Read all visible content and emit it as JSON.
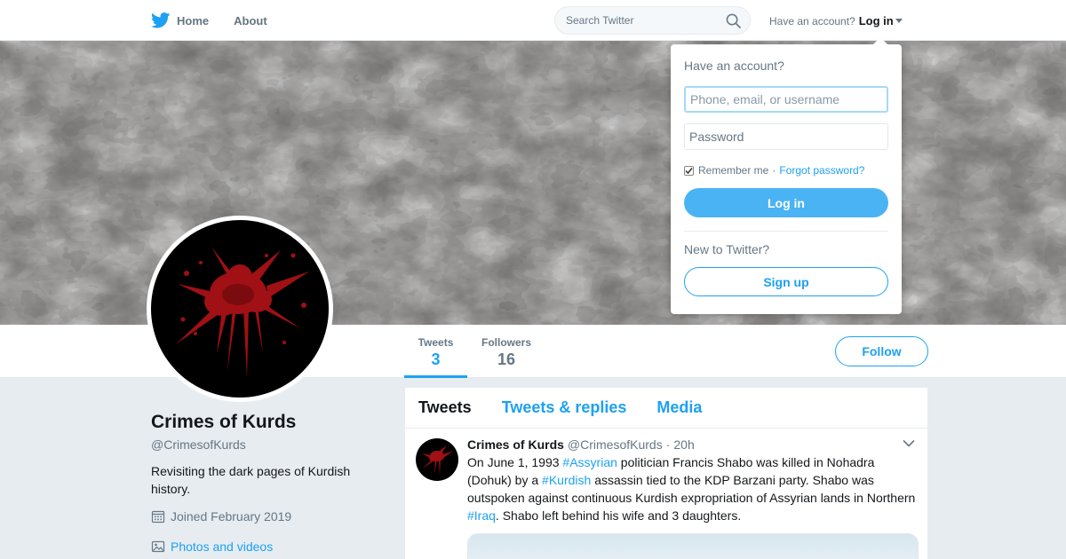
{
  "nav": {
    "home_label": "Home",
    "about_label": "About",
    "search_placeholder": "Search Twitter",
    "account_prompt": "Have an account?",
    "login_label": "Log in"
  },
  "profile": {
    "name": "Crimes of Kurds",
    "handle": "@CrimesofKurds",
    "bio": "Revisiting the dark pages of Kurdish history.",
    "joined": "Joined February 2019",
    "photos_link": "Photos and videos"
  },
  "stats": [
    {
      "label": "Tweets",
      "value": "3"
    },
    {
      "label": "Followers",
      "value": "16"
    }
  ],
  "follow_label": "Follow",
  "timeline": {
    "tabs": [
      "Tweets",
      "Tweets & replies",
      "Media"
    ],
    "tweet": {
      "name": "Crimes of Kurds",
      "handle": "@CrimesofKurds",
      "separator": "·",
      "time": "20h",
      "text_parts": [
        "On June 1, 1993 ",
        "#Assyrian",
        " politician Francis Shabo was killed in Nohadra (Dohuk) by a ",
        "#Kurdish",
        " assassin tied to the KDP Barzani party. Shabo was outspoken against continuous Kurdish expropriation of Assyrian lands in Northern ",
        "#Iraq",
        ". Shabo left behind his wife and 3 daughters."
      ]
    }
  },
  "login_dropdown": {
    "title": "Have an account?",
    "username_placeholder": "Phone, email, or username",
    "password_placeholder": "Password",
    "remember_label": "Remember me",
    "separator": "·",
    "forgot_label": "Forgot password?",
    "login_button": "Log in",
    "new_prompt": "New to Twitter?",
    "signup_button": "Sign up"
  },
  "colors": {
    "accent": "#1da1f2",
    "background": "#e6ecf0",
    "avatar_background": "#000000",
    "splatter": "#a01014"
  },
  "icons": [
    "twitter-bird-icon",
    "search-icon",
    "caret-down-icon",
    "calendar-icon",
    "image-icon",
    "chevron-down-icon",
    "checkbox-checked-icon"
  ]
}
